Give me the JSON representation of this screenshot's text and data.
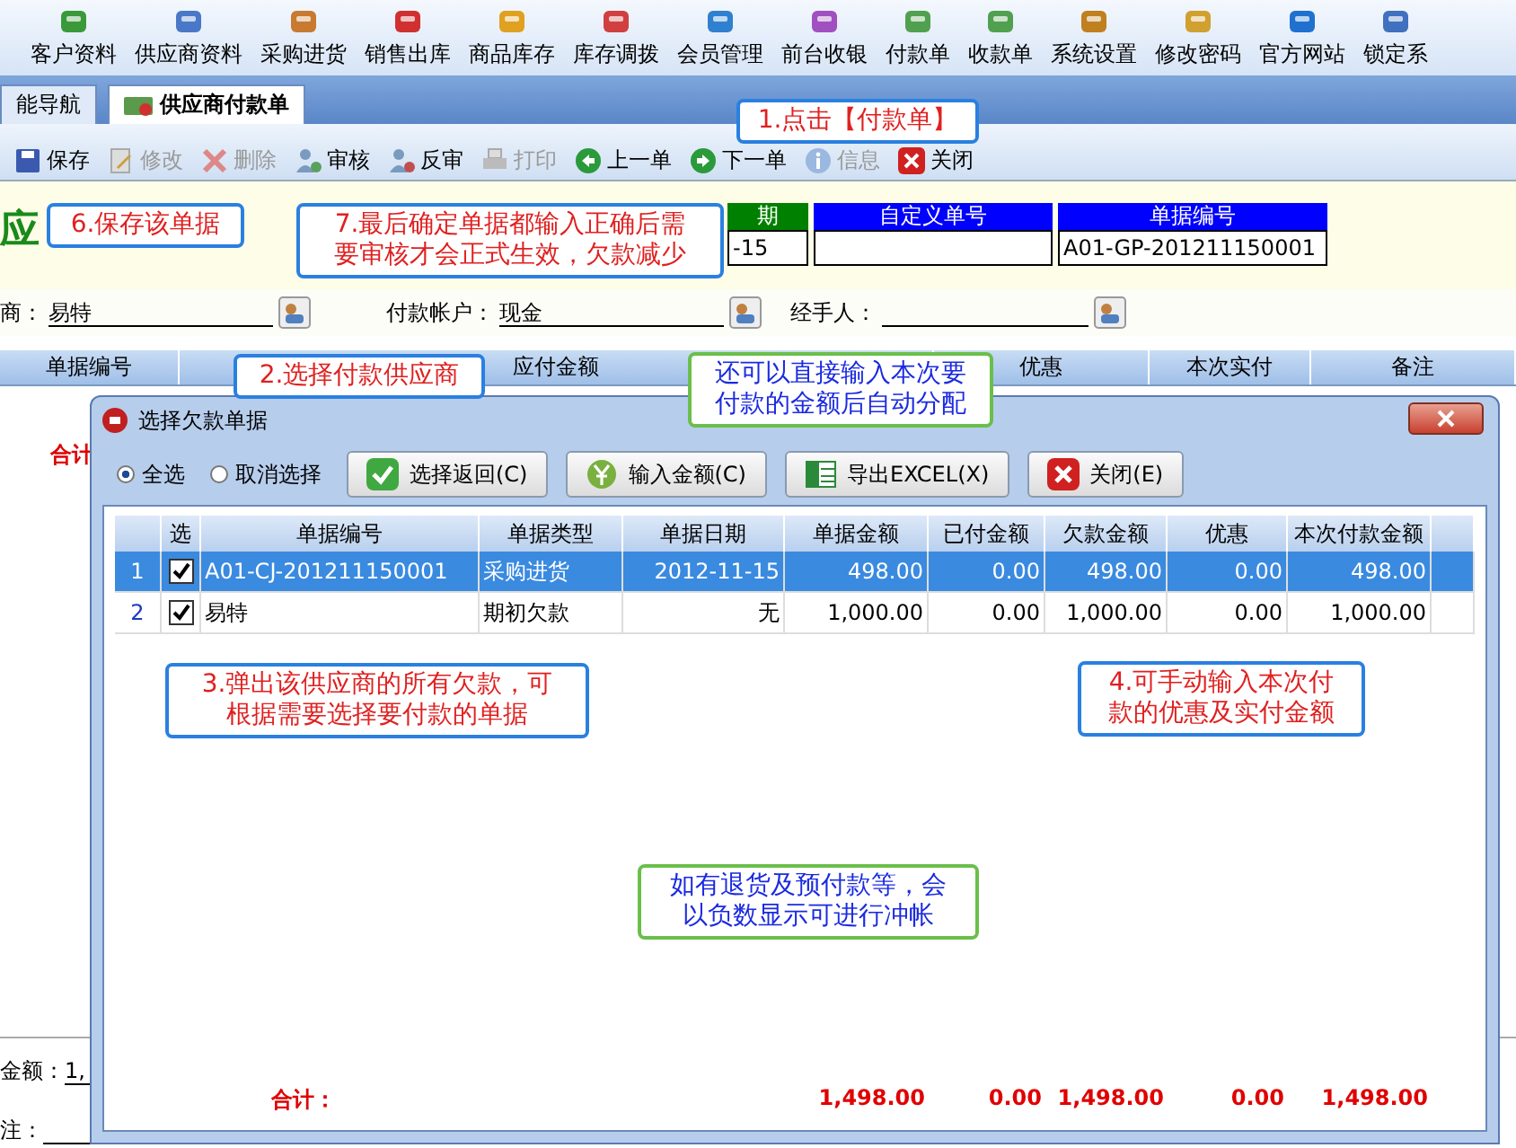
{
  "menu": [
    "客户资料",
    "供应商资料",
    "采购进货",
    "销售出库",
    "商品库存",
    "库存调拨",
    "会员管理",
    "前台收银",
    "付款单",
    "收款单",
    "系统设置",
    "修改密码",
    "官方网站",
    "锁定系"
  ],
  "tabs": [
    {
      "label": "能导航",
      "selected": false
    },
    {
      "label": "供应商付款单",
      "selected": true
    }
  ],
  "toolbar": [
    {
      "kind": "save",
      "label": "保存",
      "disabled": false
    },
    {
      "kind": "edit",
      "label": "修改",
      "disabled": true
    },
    {
      "kind": "delete",
      "label": "删除",
      "disabled": true
    },
    {
      "kind": "approve",
      "label": "审核",
      "disabled": false
    },
    {
      "kind": "unapprove",
      "label": "反审",
      "disabled": false
    },
    {
      "kind": "print",
      "label": "打印",
      "disabled": true
    },
    {
      "kind": "prev",
      "label": "上一单",
      "disabled": false
    },
    {
      "kind": "next",
      "label": "下一单",
      "disabled": false
    },
    {
      "kind": "info",
      "label": "信息",
      "disabled": true
    },
    {
      "kind": "close",
      "label": "关闭",
      "disabled": false
    }
  ],
  "form": {
    "title": "应",
    "codes": [
      {
        "label": "期",
        "value": "-15",
        "color": "#008000"
      },
      {
        "label": "自定义单号",
        "color": "#0000ff"
      },
      {
        "label": "单据编号",
        "value": "A01-GP-201211150001",
        "color": "#0000ff"
      }
    ],
    "fields": [
      {
        "label": "商：",
        "value": "易特"
      },
      {
        "label": "付款帐户：",
        "value": "现金"
      },
      {
        "label": "经手人："
      }
    ]
  },
  "grid": {
    "columns": [
      "单据编号",
      "应付金额",
      "优惠",
      "本次实付",
      "备注"
    ],
    "total_label": "合计"
  },
  "footer": [
    {
      "label": "金额：",
      "value": "1,"
    },
    {
      "label": "注："
    }
  ],
  "dialog": {
    "title": "选择欠款单据",
    "options": [
      {
        "label": "全选",
        "selected": true
      },
      {
        "label": "取消选择",
        "selected": false
      }
    ],
    "buttons": [
      {
        "kind": "confirm",
        "label": "选择返回(C)"
      },
      {
        "kind": "amount",
        "label": "输入金额(C)"
      },
      {
        "kind": "excel",
        "label": "导出EXCEL(X)"
      },
      {
        "kind": "close",
        "label": "关闭(E)"
      }
    ],
    "columns": [
      "",
      "选",
      "单据编号",
      "单据类型",
      "单据日期",
      "单据金额",
      "已付金额",
      "欠款金额",
      "优惠",
      "本次付款金额"
    ],
    "rows": [
      {
        "checked": true,
        "selected": true,
        "cells": [
          "1",
          "",
          "A01-CJ-201211150001",
          "采购进货",
          "2012-11-15",
          "498.00",
          "0.00",
          "498.00",
          "0.00",
          "498.00"
        ]
      },
      {
        "checked": true,
        "selected": false,
        "cells": [
          "2",
          "",
          "易特",
          "期初欠款",
          "无",
          "1,000.00",
          "0.00",
          "1,000.00",
          "0.00",
          "1,000.00"
        ]
      }
    ],
    "total_label": "合计：",
    "totals": [
      "1,498.00",
      "0.00",
      "1,498.00",
      "0.00",
      "1,498.00"
    ]
  },
  "callouts": [
    {
      "kind": "step",
      "lines": [
        "1.点击【付款单】"
      ]
    },
    {
      "kind": "step",
      "lines": [
        "6.保存该单据"
      ]
    },
    {
      "kind": "step",
      "lines": [
        "7.最后确定单据都输入正确后需",
        "要审核才会正式生效，欠款减少"
      ]
    },
    {
      "kind": "step",
      "lines": [
        "2.选择付款供应商"
      ]
    },
    {
      "kind": "tip",
      "lines": [
        "还可以直接输入本次要",
        "付款的金额后自动分配"
      ]
    },
    {
      "kind": "step",
      "lines": [
        "3.弹出该供应商的所有欠款，可",
        "根据需要选择要付款的单据"
      ]
    },
    {
      "kind": "step",
      "lines": [
        "4.可手动输入本次付",
        "款的优惠及实付金额"
      ]
    },
    {
      "kind": "note",
      "lines": [
        "如有退货及预付款等，会",
        "以负数显示可进行冲帐"
      ]
    }
  ]
}
